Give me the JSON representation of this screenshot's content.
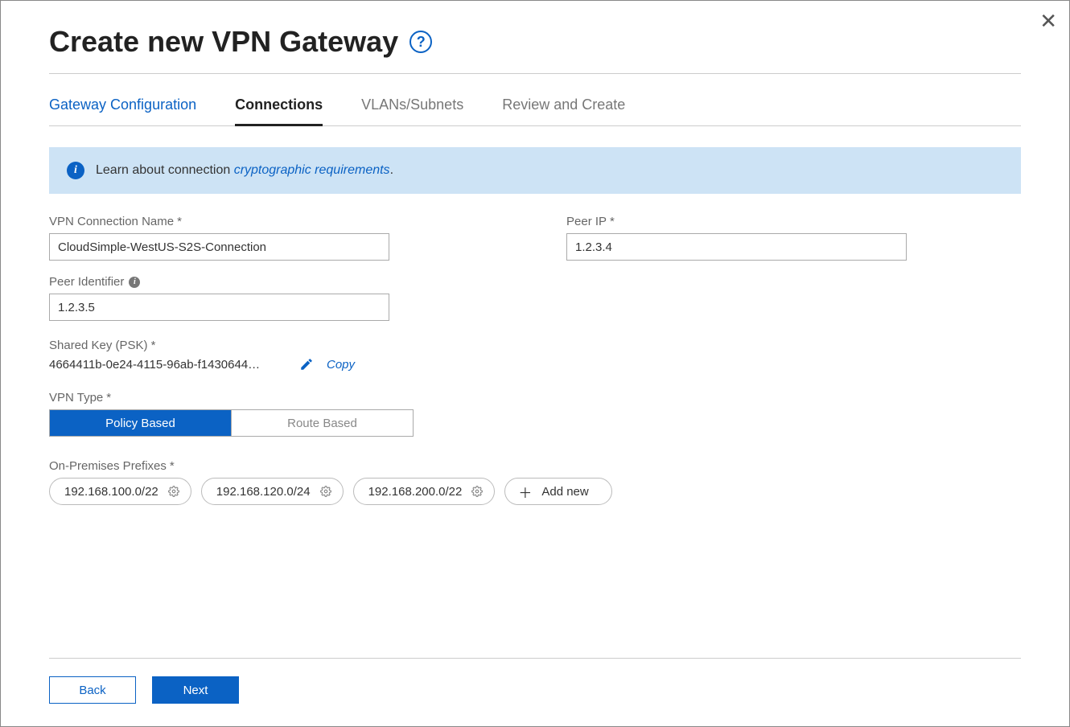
{
  "header": {
    "title": "Create new VPN Gateway"
  },
  "tabs": {
    "items": [
      {
        "label": "Gateway Configuration",
        "state": "completed"
      },
      {
        "label": "Connections",
        "state": "active"
      },
      {
        "label": "VLANs/Subnets",
        "state": "inactive"
      },
      {
        "label": "Review and Create",
        "state": "inactive"
      }
    ]
  },
  "banner": {
    "prefix": "Learn about connection ",
    "link": "cryptographic requirements",
    "suffix": "."
  },
  "form": {
    "connection_name": {
      "label": "VPN Connection Name",
      "value": "CloudSimple-WestUS-S2S-Connection"
    },
    "peer_ip": {
      "label": "Peer IP",
      "value": "1.2.3.4"
    },
    "peer_identifier": {
      "label": "Peer Identifier",
      "value": "1.2.3.5"
    },
    "shared_key": {
      "label": "Shared Key  (PSK)",
      "value": "4664411b-0e24-4115-96ab-f1430644…",
      "copy_label": "Copy"
    },
    "vpn_type": {
      "label": "VPN Type",
      "options": [
        "Policy Based",
        "Route Based"
      ],
      "selected": 0
    },
    "prefixes": {
      "label": "On-Premises Prefixes",
      "items": [
        "192.168.100.0/22",
        "192.168.120.0/24",
        "192.168.200.0/22"
      ],
      "add_label": "Add new"
    }
  },
  "footer": {
    "back": "Back",
    "next": "Next"
  }
}
